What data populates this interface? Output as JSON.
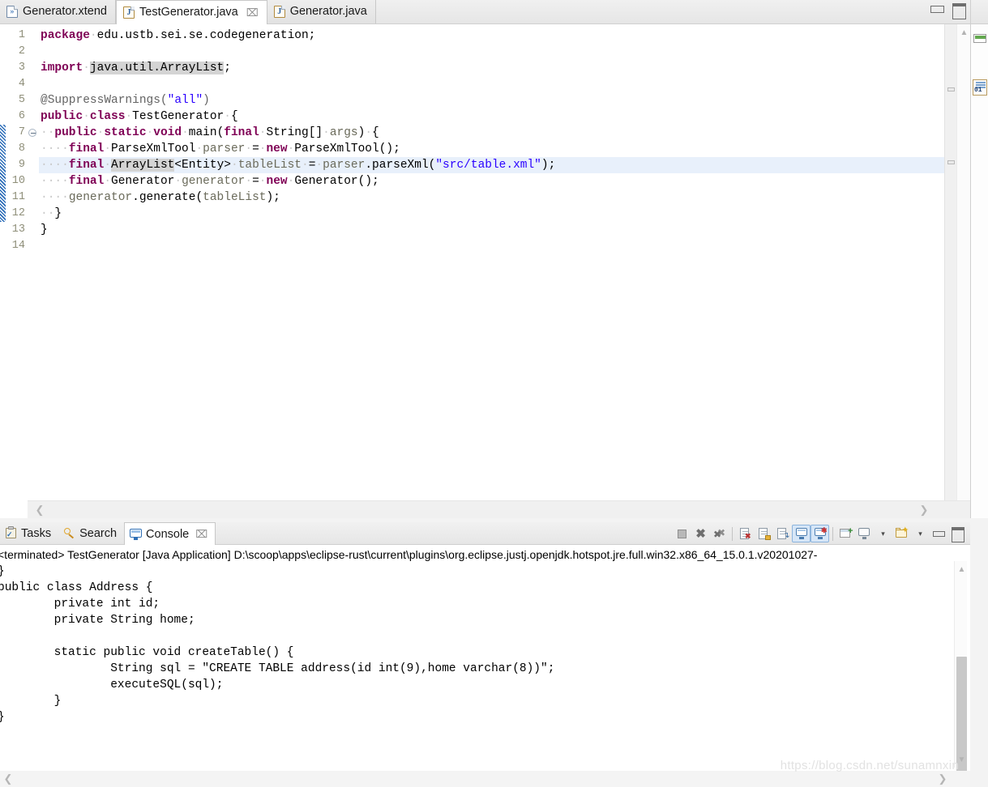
{
  "editor": {
    "tabs": [
      {
        "label": "Generator.xtend",
        "icon": "xtend-file-icon",
        "glyph": "»",
        "active": false,
        "closable": false
      },
      {
        "label": "TestGenerator.java",
        "icon": "java-file-icon",
        "glyph": "J",
        "active": true,
        "closable": true
      },
      {
        "label": "Generator.java",
        "icon": "java-file-icon",
        "glyph": "J",
        "active": false,
        "closable": false
      }
    ],
    "close_glyph": "⌧",
    "view_buttons": {
      "minimize": "Minimize",
      "maximize": "Maximize"
    },
    "line_numbers": [
      "1",
      "2",
      "3",
      "4",
      "5",
      "6",
      "7",
      "8",
      "9",
      "10",
      "11",
      "12",
      "13",
      "14"
    ],
    "lines": [
      {
        "n": 1,
        "text": "package edu.ustb.sei.se.codegeneration;"
      },
      {
        "n": 2,
        "text": ""
      },
      {
        "n": 3,
        "text": "import java.util.ArrayList;"
      },
      {
        "n": 4,
        "text": ""
      },
      {
        "n": 5,
        "text": "@SuppressWarnings(\"all\")"
      },
      {
        "n": 6,
        "text": "public class TestGenerator {"
      },
      {
        "n": 7,
        "text": "  public static void main(final String[] args) {"
      },
      {
        "n": 8,
        "text": "    final ParseXmlTool parser = new ParseXmlTool();"
      },
      {
        "n": 9,
        "text": "    final ArrayList<Entity> tableList = parser.parseXml(\"src/table.xml\");"
      },
      {
        "n": 10,
        "text": "    final Generator generator = new Generator();"
      },
      {
        "n": 11,
        "text": "    generator.generate(tableList);"
      },
      {
        "n": 12,
        "text": "  }"
      },
      {
        "n": 13,
        "text": "}"
      },
      {
        "n": 14,
        "text": ""
      }
    ],
    "highlighted_line": 9,
    "folding_line": 7,
    "scroll_arrows": {
      "up": "▲",
      "down": "▼",
      "left": "❮",
      "right": "❯"
    },
    "colors": {
      "keyword": "#7f0055",
      "string": "#2a00ff",
      "annotation": "#646464",
      "local_var": "#6a6a5a",
      "highlight_line_bg": "#e8f0fb",
      "occurrence_bg": "#d4d4d4",
      "change_bar": "#2b6cb8"
    }
  },
  "console": {
    "tabs": [
      {
        "label": "Tasks",
        "icon": "tasks-icon",
        "active": false,
        "closable": false
      },
      {
        "label": "Search",
        "icon": "search-icon",
        "active": false,
        "closable": false
      },
      {
        "label": "Console",
        "icon": "console-icon",
        "active": true,
        "closable": true
      }
    ],
    "close_glyph": "⌧",
    "toolbar": [
      {
        "name": "terminate-button",
        "title": "Terminate"
      },
      {
        "name": "remove-launch-button",
        "title": "Remove Launch"
      },
      {
        "name": "remove-all-terminated-button",
        "title": "Remove All Terminated Launches"
      },
      {
        "name": "clear-console-button",
        "title": "Clear Console"
      },
      {
        "name": "scroll-lock-button",
        "title": "Scroll Lock"
      },
      {
        "name": "word-wrap-button",
        "title": "Word Wrap"
      },
      {
        "name": "show-console-on-output-button",
        "title": "Show Console When Standard Out Changes",
        "toggled": true
      },
      {
        "name": "show-console-on-error-button",
        "title": "Show Console When Standard Error Changes",
        "toggled": true
      },
      {
        "name": "pin-console-button",
        "title": "Pin Console"
      },
      {
        "name": "display-selected-console-button",
        "title": "Display Selected Console"
      },
      {
        "name": "display-selected-console-dropdown",
        "title": "Display Selected Console Menu"
      },
      {
        "name": "open-console-button",
        "title": "Open Console"
      },
      {
        "name": "open-console-dropdown",
        "title": "Open Console Menu"
      },
      {
        "name": "minimize-button",
        "title": "Minimize"
      },
      {
        "name": "maximize-button",
        "title": "Maximize"
      }
    ],
    "caret_glyph": "▾",
    "process_line": "<terminated> TestGenerator [Java Application] D:\\scoop\\apps\\eclipse-rust\\current\\plugins\\org.eclipse.justj.openjdk.hotspot.jre.full.win32.x86_64_15.0.1.v20201027-",
    "output": "}\npublic class Address {\n        private int id;\n        private String home;\n\n        static public void createTable() {\n                String sql = \"CREATE TABLE address(id int(9),home varchar(8))\";\n                executeSQL(sql);\n        }\n}",
    "scroll_arrows": {
      "up": "▲",
      "down": "▼",
      "left": "❮",
      "right": "❯"
    }
  },
  "watermark": {
    "text": "https://blog.csdn.net/sunamnxin"
  }
}
